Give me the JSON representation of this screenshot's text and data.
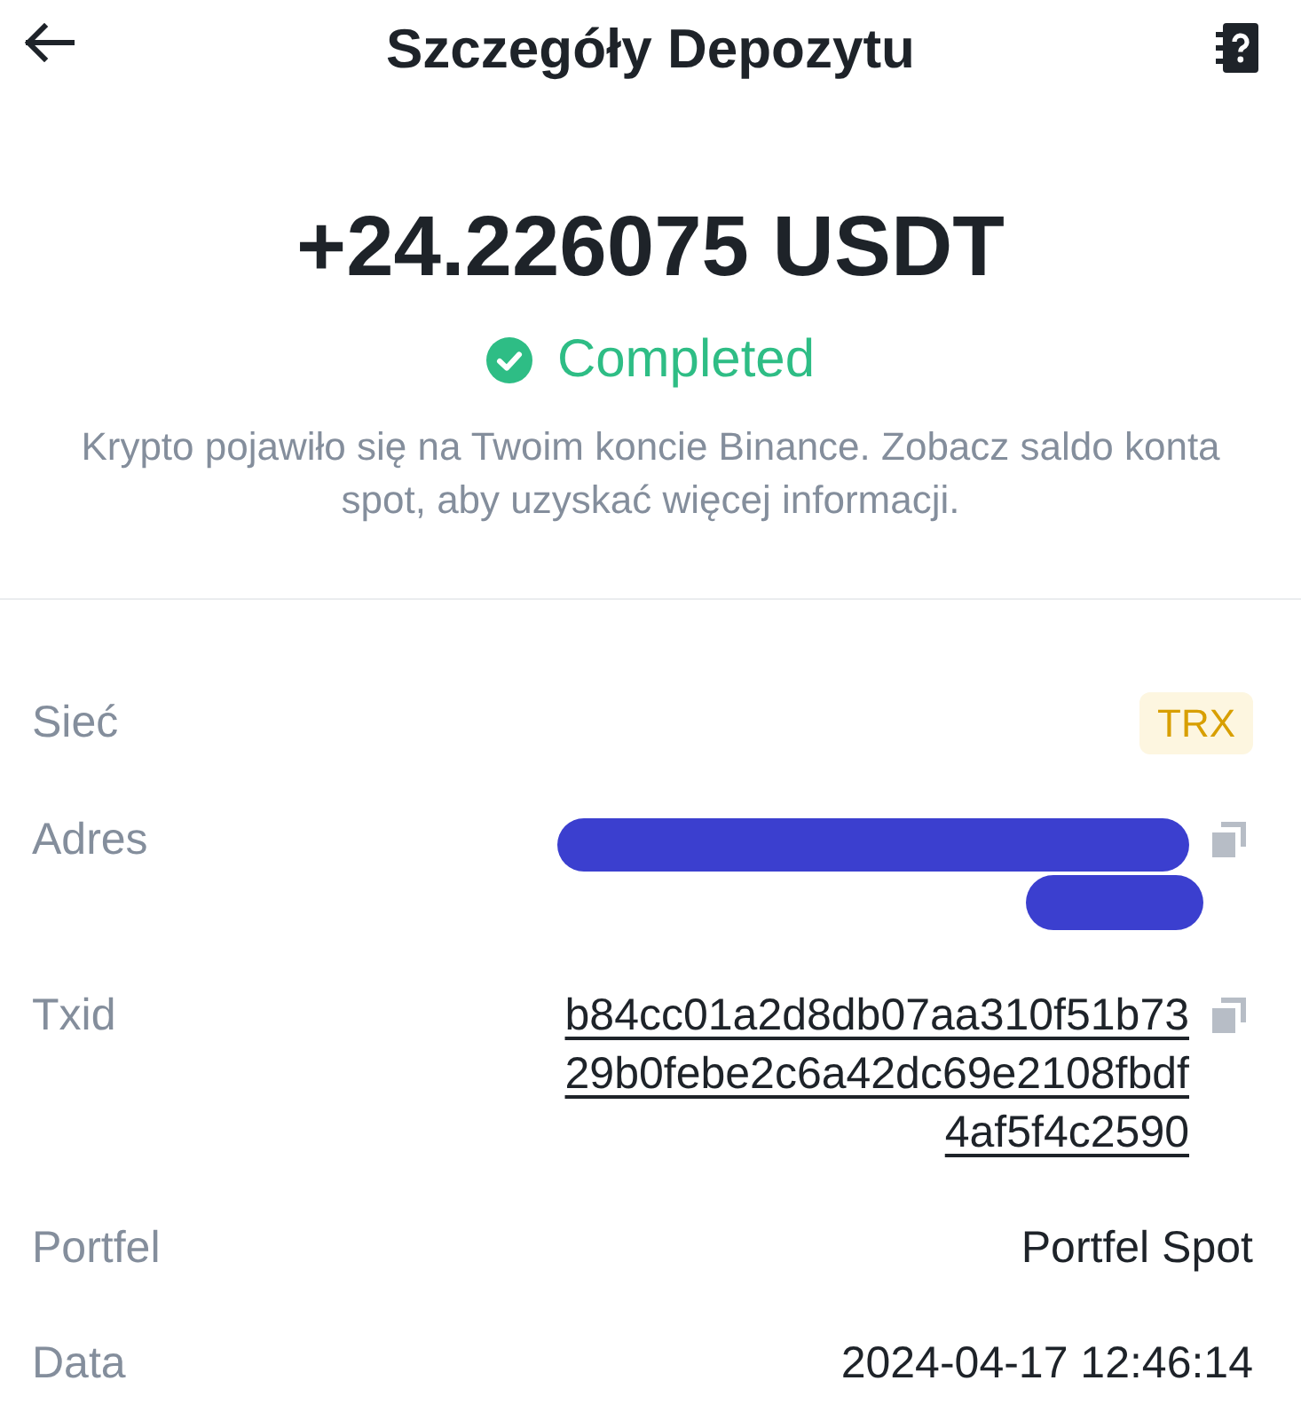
{
  "header": {
    "title": "Szczegóły Depozytu"
  },
  "amount": "+24.226075 USDT",
  "status": {
    "label": "Completed",
    "kind": "completed"
  },
  "description": "Krypto pojawiło się na Twoim koncie Binance. Zobacz saldo konta spot, aby uzyskać więcej informacji.",
  "details": [
    {
      "label": "Sieć",
      "kind": "badge",
      "value": "TRX",
      "copyable": false
    },
    {
      "label": "Adres",
      "kind": "redacted",
      "copyable": true
    },
    {
      "label": "Txid",
      "kind": "link",
      "value": "b84cc01a2d8db07aa310f51b7329b0febe2c6a42dc69e2108fbdf4af5f4c2590",
      "copyable": true
    },
    {
      "label": "Portfel",
      "kind": "text",
      "value": "Portfel Spot",
      "copyable": false
    },
    {
      "label": "Data",
      "kind": "text",
      "value": "2024-04-17 12:46:14",
      "copyable": false
    }
  ]
}
